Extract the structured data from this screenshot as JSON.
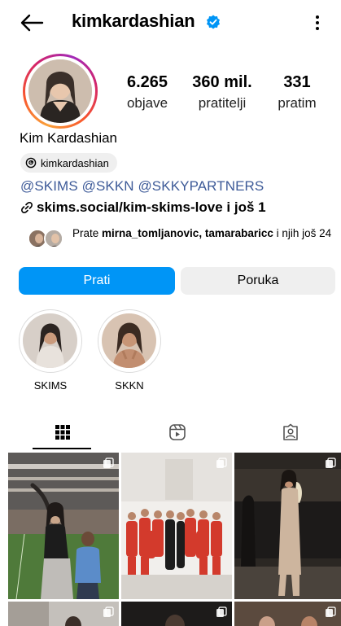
{
  "header": {
    "username": "kimkardashian"
  },
  "profile": {
    "stats": [
      {
        "value": "6.265",
        "label": "objave"
      },
      {
        "value": "360 mil.",
        "label": "pratitelji"
      },
      {
        "value": "331",
        "label": "pratim"
      }
    ],
    "full_name": "Kim Kardashian",
    "threads_handle": "kimkardashian",
    "mentions": "@SKIMS @SKKN @SKKYPARTNERS",
    "link_text": "skims.social/kim-skims-love i još 1",
    "followed_by": {
      "prefix": "Prate ",
      "names": "mirna_tomljanovic, tamarabaricc",
      "suffix": " i njih još 24"
    }
  },
  "actions": {
    "follow_label": "Prati",
    "message_label": "Poruka"
  },
  "highlights": [
    {
      "label": "SKIMS"
    },
    {
      "label": "SKKN"
    }
  ],
  "colors": {
    "accent": "#0095f6",
    "verified": "#0095f6",
    "mention": "#3d5a98"
  }
}
